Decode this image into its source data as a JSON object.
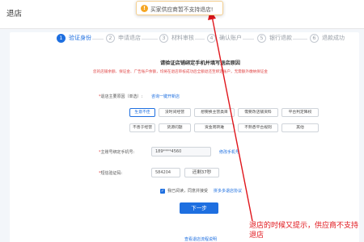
{
  "header": {
    "title": "退店"
  },
  "toast": {
    "text": "买家供应商暂不支持退店!"
  },
  "steps": [
    {
      "num": "1",
      "label": "验证身份"
    },
    {
      "num": "2",
      "label": "申请退店"
    },
    {
      "num": "3",
      "label": "材料审核"
    },
    {
      "num": "4",
      "label": "确认账户"
    },
    {
      "num": "5",
      "label": "银行退款"
    },
    {
      "num": "6",
      "label": "退款成功"
    }
  ],
  "form": {
    "section_title": "请验证店铺绑定手机并填写退店原因",
    "notice": "您的店铺余额、保证金、广告账户余额，均将在退店审核成功后全额退还至绑定账户，无需额外缴纳保证金",
    "reason_label": "退店主要原因（单选）:",
    "reason_help": "咨询一键开新店",
    "reasons": [
      [
        "生意不佳",
        "没时间经营",
        "想要换主营类目",
        "需要改店铺资料",
        "平台判定降权"
      ],
      [
        "不善于经营",
        "货源问题",
        "资金周转难",
        "不熟悉平台规则",
        "其他"
      ]
    ],
    "phone_label": "主账号绑定手机号:",
    "phone_value": "189****4560",
    "phone_link": "修改手机号",
    "code_label": "短信验证码:",
    "code_value": "584204",
    "code_btn": "还剩37秒",
    "agree_text": "我已阅读，同意并接受",
    "agree_link": "拼多多退店协议",
    "next_btn": "下一步",
    "bottom_link": "查看退店流程说明"
  },
  "annotation": {
    "text": "退店的时候又提示，供应商不支持退店"
  },
  "colors": {
    "primary": "#1e6fe0",
    "warning": "#f5a623",
    "annotation": "#e0151b"
  }
}
